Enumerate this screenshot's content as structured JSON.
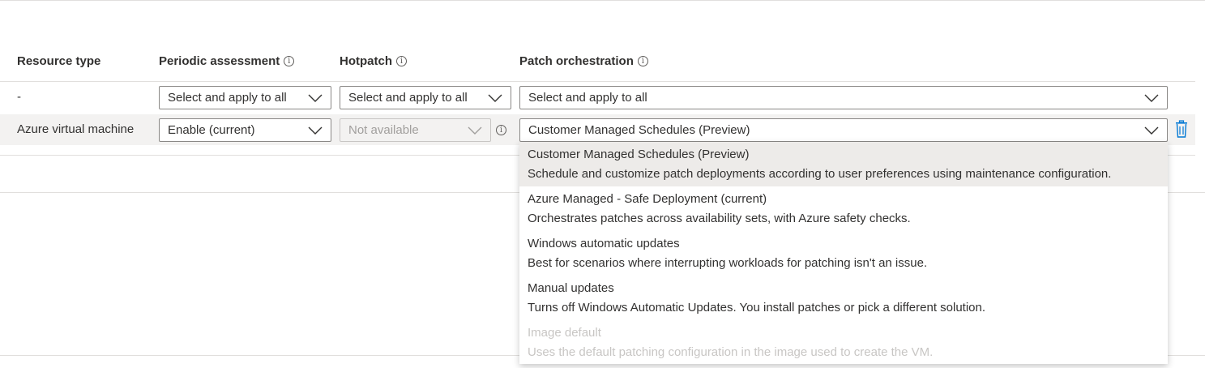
{
  "table": {
    "headers": {
      "resource_type": "Resource type",
      "periodic_assessment": "Periodic assessment",
      "hotpatch": "Hotpatch",
      "patch_orchestration": "Patch orchestration"
    },
    "apply_all_row": {
      "resource": "-",
      "periodic_assessment": "Select and apply to all",
      "hotpatch": "Select and apply to all",
      "patch_orchestration": "Select and apply to all"
    },
    "vm_row": {
      "resource": "Azure virtual machine",
      "periodic_assessment": "Enable (current)",
      "hotpatch": "Not available",
      "patch_orchestration": "Customer Managed Schedules (Preview)"
    }
  },
  "patch_menu": {
    "options": [
      {
        "title": "Customer Managed Schedules (Preview)",
        "description": "Schedule and customize patch deployments according to user preferences using maintenance configuration.",
        "selected": true,
        "disabled": false
      },
      {
        "title": "Azure Managed - Safe Deployment (current)",
        "description": "Orchestrates patches across availability sets, with Azure safety checks.",
        "selected": false,
        "disabled": false
      },
      {
        "title": "Windows automatic updates",
        "description": "Best for scenarios where interrupting workloads for patching isn't an issue.",
        "selected": false,
        "disabled": false
      },
      {
        "title": "Manual updates",
        "description": "Turns off Windows Automatic Updates. You install patches or pick a different solution.",
        "selected": false,
        "disabled": false
      },
      {
        "title": "Image default",
        "description": "Uses the default patching configuration in the image used to create the VM.",
        "selected": false,
        "disabled": true
      }
    ]
  },
  "icons": {
    "info": "info-icon",
    "chevron": "chevron-down-icon",
    "delete": "trash-icon"
  },
  "colors": {
    "accent": "#0078d4",
    "selected_bg": "#edebe9",
    "row_highlight": "#f3f2f1"
  }
}
